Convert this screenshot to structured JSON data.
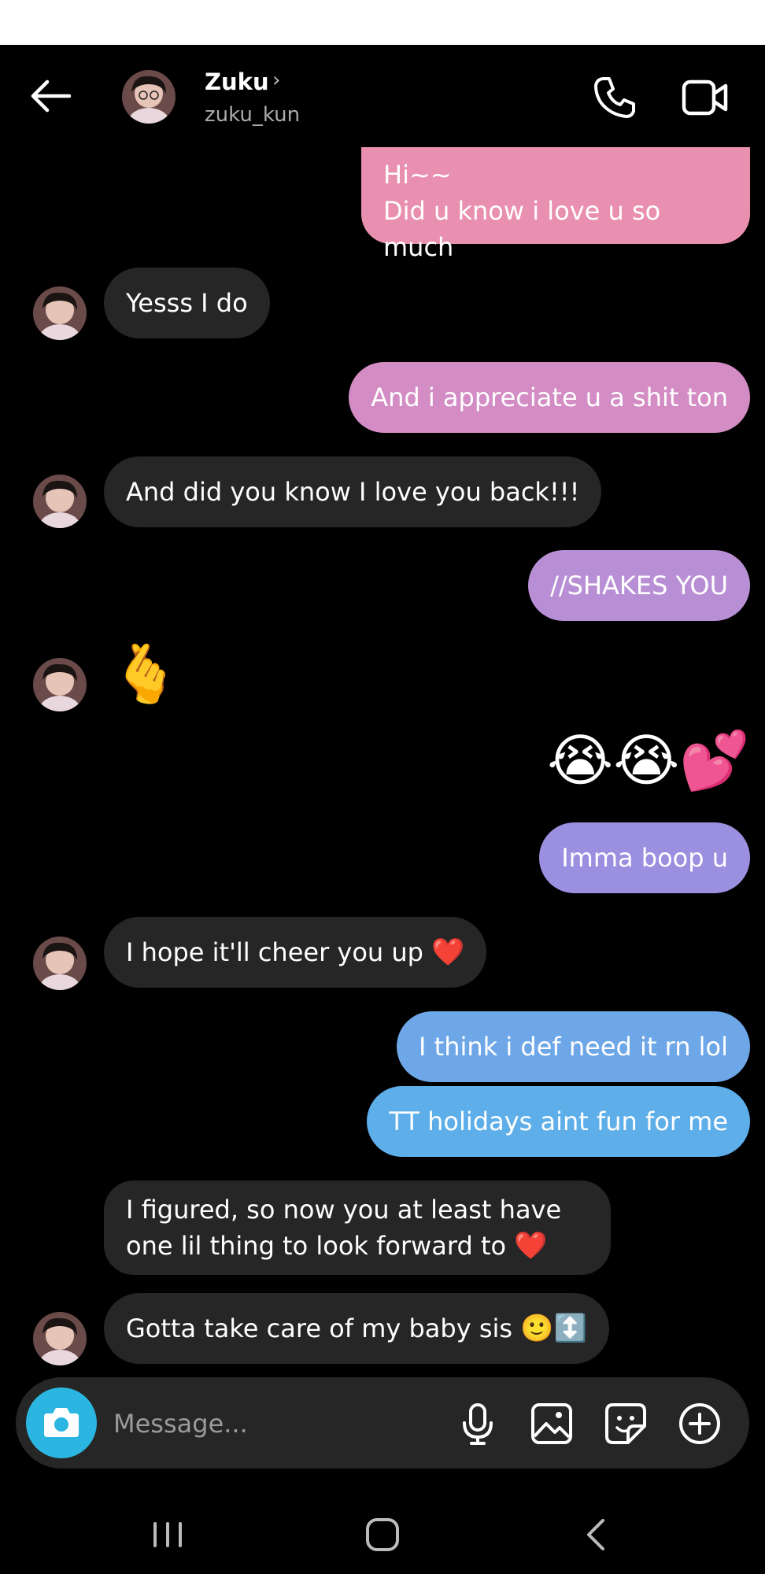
{
  "header": {
    "name": "Zuku",
    "chevron": "›",
    "username": "zuku_kun"
  },
  "messages": [
    {
      "from": "me",
      "lines": [
        "Hi~~",
        "Did u know i love u so much"
      ],
      "color": "#e98fb0"
    },
    {
      "from": "them",
      "text": "Yesss I do"
    },
    {
      "from": "me",
      "text": "And i appreciate u a shit ton",
      "color": "#d48cc4"
    },
    {
      "from": "them",
      "text": "And did you know I love you back!!!"
    },
    {
      "from": "me",
      "text": "//SHAKES YOU",
      "color": "#b88fd4"
    },
    {
      "from": "them",
      "emoji": "🫰"
    },
    {
      "from": "me",
      "emoji": "😭😭💕"
    },
    {
      "from": "me",
      "text": "Imma boop u",
      "color": "#9b8fe0"
    },
    {
      "from": "them",
      "text": "I hope it'll cheer you up",
      "emoji": "❤️"
    },
    {
      "from": "me",
      "text": "I think i def need it rn lol",
      "color": "#6ea7e8"
    },
    {
      "from": "me",
      "text": "TT holidays aint fun for me",
      "color": "#5eaeea"
    },
    {
      "from": "them",
      "lines": [
        "I figured, so now you at least have",
        "one lil thing to look forward to"
      ],
      "emoji": "❤️"
    },
    {
      "from": "them",
      "text": "Gotta take care of my baby sis",
      "emoji": "🙂↕️"
    }
  ],
  "composer": {
    "placeholder": "Message..."
  },
  "icons": {
    "back": "arrow-left-icon",
    "call": "phone-icon",
    "video": "video-camera-icon",
    "camera": "camera-icon",
    "mic": "microphone-icon",
    "gallery": "image-icon",
    "sticker": "sticker-icon",
    "plus": "plus-circle-icon"
  },
  "colors": {
    "background": "#000000",
    "received_bubble": "#262626",
    "camera_button": "#2ab6e0"
  }
}
